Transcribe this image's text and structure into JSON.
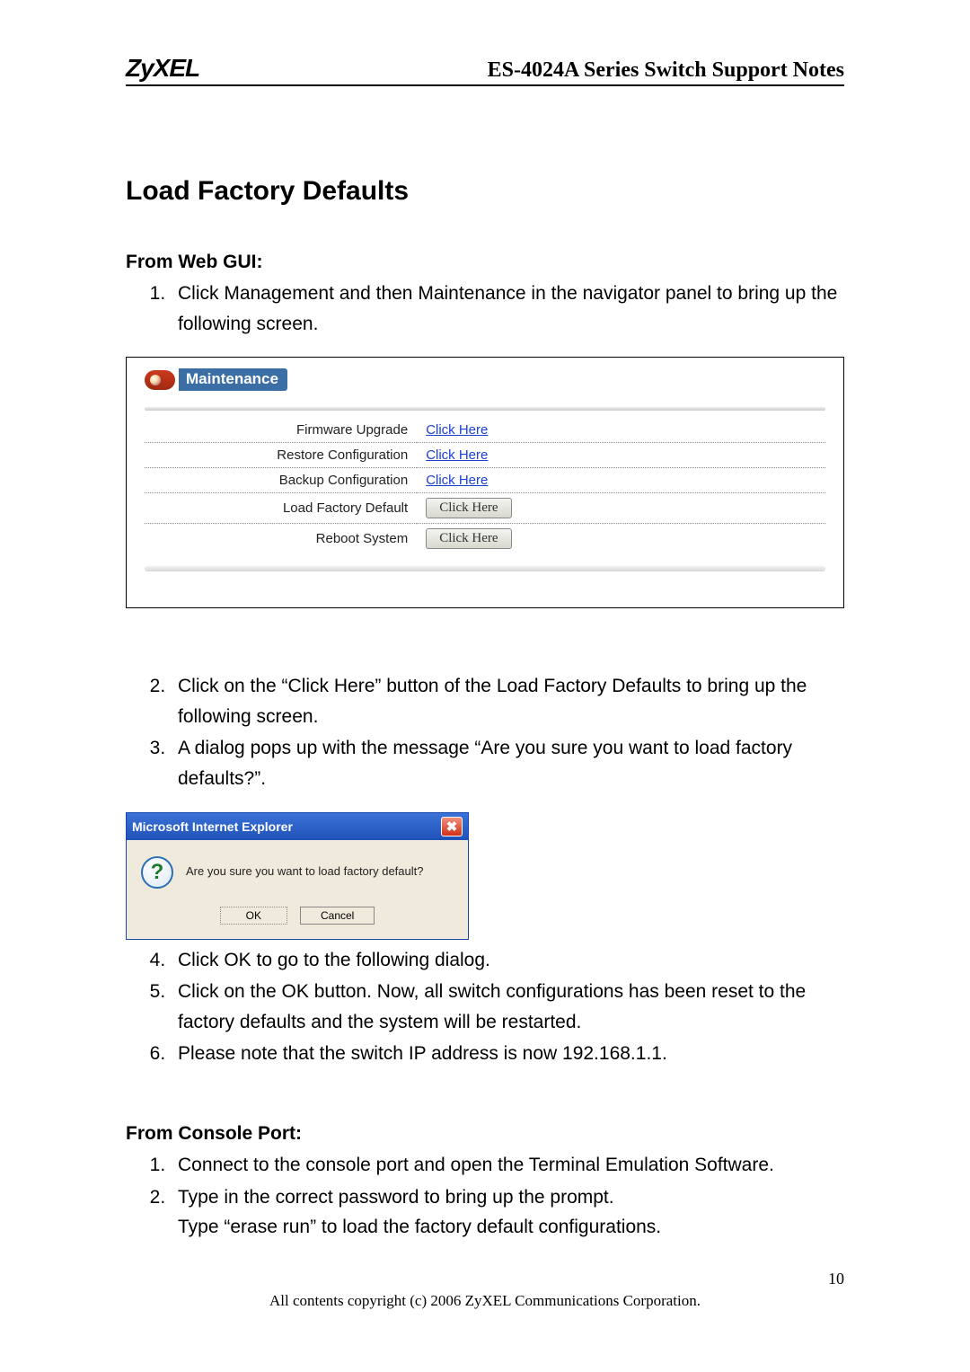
{
  "header": {
    "logo": "ZyXEL",
    "title": "ES-4024A Series Switch Support Notes"
  },
  "section_title": "Load Factory Defaults",
  "web_gui": {
    "heading": "From Web GUI:",
    "step1": "Click Management and then Maintenance in the navigator panel to bring up the following screen.",
    "step2": "Click on the “Click Here” button of the Load Factory Defaults to bring up the following screen.",
    "step3": "A dialog pops up with the message “Are you sure you want to load factory defaults?”.",
    "step4": "Click OK to go to the following dialog.",
    "step5": "Click on the OK button. Now, all switch configurations has been reset to the factory defaults and the system will be restarted.",
    "step6": "Please note that the switch IP address is now 192.168.1.1."
  },
  "maintenance": {
    "banner": "Maintenance",
    "rows": [
      {
        "label": "Firmware Upgrade",
        "action_type": "link",
        "action_text": "Click Here"
      },
      {
        "label": "Restore Configuration",
        "action_type": "link",
        "action_text": "Click Here"
      },
      {
        "label": "Backup Configuration",
        "action_type": "link",
        "action_text": "Click Here"
      },
      {
        "label": "Load Factory Default",
        "action_type": "button",
        "action_text": "Click Here"
      },
      {
        "label": "Reboot System",
        "action_type": "button",
        "action_text": "Click Here"
      }
    ]
  },
  "dialog": {
    "title": "Microsoft Internet Explorer",
    "message": "Are you sure you want to load factory default?",
    "ok": "OK",
    "cancel": "Cancel",
    "close": "✖"
  },
  "console": {
    "heading": "From Console Port:",
    "step1": "Connect to the console port and open the Terminal Emulation Software.",
    "step2a": "Type in the correct password to bring up the prompt.",
    "step2b": "Type “erase run” to load the factory default configurations."
  },
  "footer": {
    "page": "10",
    "copyright": "All contents copyright (c) 2006 ZyXEL Communications Corporation."
  }
}
